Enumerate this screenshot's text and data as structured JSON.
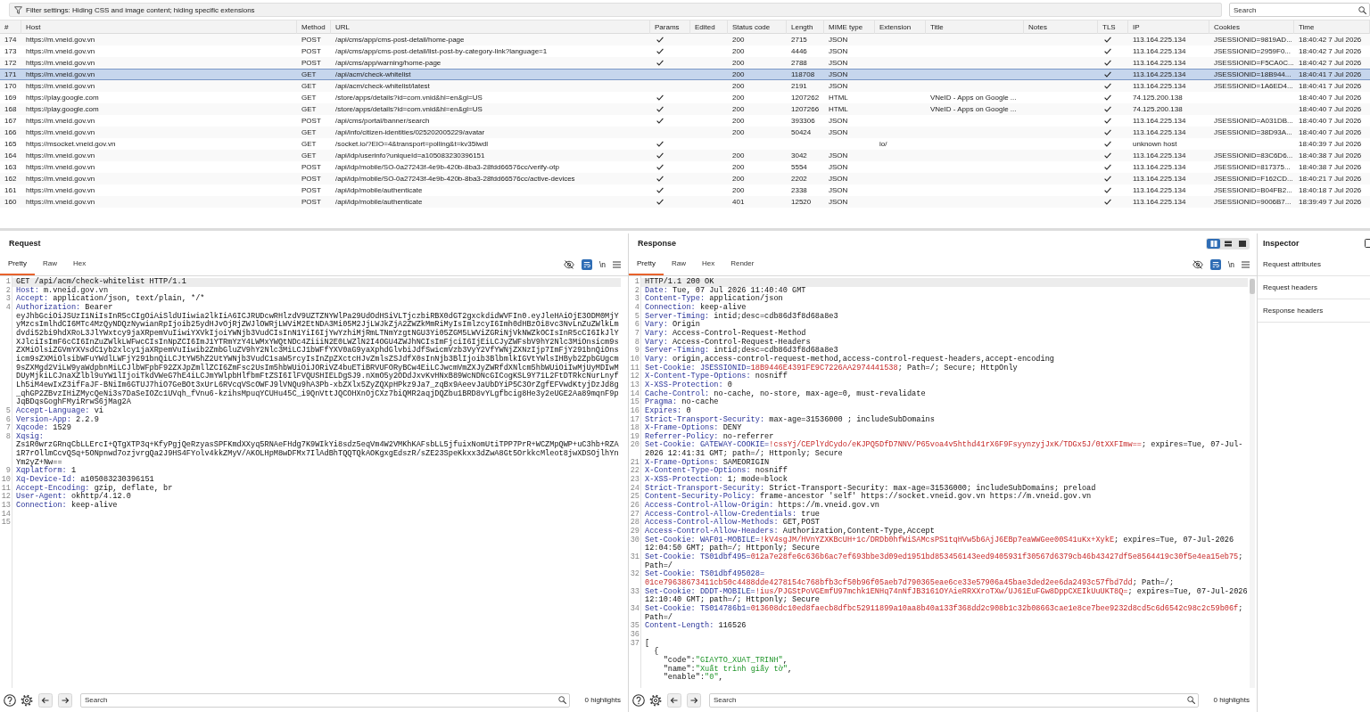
{
  "filter_bar": {
    "text": "Filter settings: Hiding CSS and image content; hiding specific extensions"
  },
  "search": {
    "placeholder": "Search"
  },
  "table": {
    "columns": [
      "#",
      "Host",
      "Method",
      "URL",
      "Params",
      "Edited",
      "Status code",
      "Length",
      "MIME type",
      "Extension",
      "Title",
      "Notes",
      "TLS",
      "IP",
      "Cookies",
      "Time"
    ],
    "rows": [
      {
        "num": "174",
        "host": "https://m.vneid.gov.vn",
        "method": "POST",
        "url": "/api/cms/app/cms-post-detail/home-page",
        "params": true,
        "status": "200",
        "length": "2715",
        "mime": "JSON",
        "tls": true,
        "ip": "113.164.225.134",
        "cookies": "JSESSIONID=9819AD...",
        "time": "18:40:42 7 Jul 2026",
        "selected": false
      },
      {
        "num": "173",
        "host": "https://m.vneid.gov.vn",
        "method": "POST",
        "url": "/api/cms/app/cms-post-detail/list-post-by-category-link?language=1",
        "params": true,
        "status": "200",
        "length": "4446",
        "mime": "JSON",
        "tls": true,
        "ip": "113.164.225.134",
        "cookies": "JSESSIONID=2959F0...",
        "time": "18:40:42 7 Jul 2026",
        "selected": false
      },
      {
        "num": "172",
        "host": "https://m.vneid.gov.vn",
        "method": "POST",
        "url": "/api/cms/app/warning/home-page",
        "params": true,
        "status": "200",
        "length": "2788",
        "mime": "JSON",
        "tls": true,
        "ip": "113.164.225.134",
        "cookies": "JSESSIONID=F5CA0C...",
        "time": "18:40:42 7 Jul 2026",
        "selected": false
      },
      {
        "num": "171",
        "host": "https://m.vneid.gov.vn",
        "method": "GET",
        "url": "/api/acm/check-whitelist",
        "params": false,
        "status": "200",
        "length": "118708",
        "mime": "JSON",
        "tls": true,
        "ip": "113.164.225.134",
        "cookies": "JSESSIONID=18B944...",
        "time": "18:40:41 7 Jul 2026",
        "selected": true
      },
      {
        "num": "170",
        "host": "https://m.vneid.gov.vn",
        "method": "GET",
        "url": "/api/acm/check-whitelist/latest",
        "params": false,
        "status": "200",
        "length": "2191",
        "mime": "JSON",
        "tls": true,
        "ip": "113.164.225.134",
        "cookies": "JSESSIONID=1A6ED4...",
        "time": "18:40:41 7 Jul 2026",
        "selected": false
      },
      {
        "num": "169",
        "host": "https://play.google.com",
        "method": "GET",
        "url": "/store/apps/details?id=com.vnid&hl=en&gl=US",
        "params": true,
        "status": "200",
        "length": "1207262",
        "mime": "HTML",
        "title": "VNeID - Apps on Google ...",
        "tls": true,
        "ip": "74.125.200.138",
        "time": "18:40:40 7 Jul 2026",
        "selected": false
      },
      {
        "num": "168",
        "host": "https://play.google.com",
        "method": "GET",
        "url": "/store/apps/details?id=com.vnid&hl=en&gl=US",
        "params": true,
        "status": "200",
        "length": "1207266",
        "mime": "HTML",
        "title": "VNeID - Apps on Google ...",
        "tls": true,
        "ip": "74.125.200.138",
        "time": "18:40:40 7 Jul 2026",
        "selected": false
      },
      {
        "num": "167",
        "host": "https://m.vneid.gov.vn",
        "method": "POST",
        "url": "/api/cms/portal/banner/search",
        "params": true,
        "status": "200",
        "length": "393306",
        "mime": "JSON",
        "tls": true,
        "ip": "113.164.225.134",
        "cookies": "JSESSIONID=A031DB...",
        "time": "18:40:40 7 Jul 2026",
        "selected": false
      },
      {
        "num": "166",
        "host": "https://m.vneid.gov.vn",
        "method": "GET",
        "url": "/api/info/citizen-identities/025202005229/avatar",
        "params": false,
        "status": "200",
        "length": "50424",
        "mime": "JSON",
        "tls": true,
        "ip": "113.164.225.134",
        "cookies": "JSESSIONID=38D93A...",
        "time": "18:40:40 7 Jul 2026",
        "selected": false
      },
      {
        "num": "165",
        "host": "https://msocket.vneid.gov.vn",
        "method": "GET",
        "url": "/socket.io/?EIO=4&transport=polling&t=kv35lwdl",
        "params": true,
        "extension": "io/",
        "tls": true,
        "ip": "unknown host",
        "time": "18:40:39 7 Jul 2026",
        "selected": false
      },
      {
        "num": "164",
        "host": "https://m.vneid.gov.vn",
        "method": "GET",
        "url": "/api/idp/userinfo?uniqueId=a105083230396151",
        "params": true,
        "status": "200",
        "length": "3042",
        "mime": "JSON",
        "tls": true,
        "ip": "113.164.225.134",
        "cookies": "JSESSIONID=83C6D6...",
        "time": "18:40:38 7 Jul 2026",
        "selected": false
      },
      {
        "num": "163",
        "host": "https://m.vneid.gov.vn",
        "method": "POST",
        "url": "/api/idp/mobile/SO-0a27243f-4e9b-420b-8ba3-28fdd66576cc/verify-otp",
        "params": true,
        "status": "200",
        "length": "5554",
        "mime": "JSON",
        "tls": true,
        "ip": "113.164.225.134",
        "cookies": "JSESSIONID=817375...",
        "time": "18:40:38 7 Jul 2026",
        "selected": false
      },
      {
        "num": "162",
        "host": "https://m.vneid.gov.vn",
        "method": "POST",
        "url": "/api/idp/mobile/SO-0a27243f-4e9b-420b-8ba3-28fdd66576cc/active-devices",
        "params": true,
        "status": "200",
        "length": "2202",
        "mime": "JSON",
        "tls": true,
        "ip": "113.164.225.134",
        "cookies": "JSESSIONID=F162CD...",
        "time": "18:40:21 7 Jul 2026",
        "selected": false
      },
      {
        "num": "161",
        "host": "https://m.vneid.gov.vn",
        "method": "POST",
        "url": "/api/idp/mobile/authenticate",
        "params": true,
        "status": "200",
        "length": "2338",
        "mime": "JSON",
        "tls": true,
        "ip": "113.164.225.134",
        "cookies": "JSESSIONID=B04FB2...",
        "time": "18:40:18 7 Jul 2026",
        "selected": false
      },
      {
        "num": "160",
        "host": "https://m.vneid.gov.vn",
        "method": "POST",
        "url": "/api/idp/mobile/authenticate",
        "params": true,
        "status": "401",
        "length": "12520",
        "mime": "JSON",
        "tls": true,
        "ip": "113.164.225.134",
        "cookies": "JSESSIONID=9006B7...",
        "time": "18:39:49 7 Jul 2026",
        "selected": false
      }
    ]
  },
  "request": {
    "title": "Request",
    "tabs": [
      {
        "label": "Pretty",
        "selected": true
      },
      {
        "label": "Raw",
        "selected": false
      },
      {
        "label": "Hex",
        "selected": false
      }
    ],
    "toolbar": {
      "wrap_on": true,
      "newline": "\\n"
    },
    "lines": [
      {
        "num": "1",
        "current": true,
        "segments": [
          {
            "kind": "plain",
            "text": "GET /api/acm/check-whitelist HTTP/1.1"
          }
        ]
      },
      {
        "num": "2",
        "current": false,
        "segments": [
          {
            "kind": "key",
            "text": "Host:"
          },
          {
            "kind": "value",
            "text": " m.vneid.gov.vn"
          }
        ]
      },
      {
        "num": "3",
        "current": false,
        "segments": [
          {
            "kind": "key",
            "text": "Accept:"
          },
          {
            "kind": "value",
            "text": " application/json, text/plain, */*"
          }
        ]
      },
      {
        "num": "4",
        "current": false,
        "segments": [
          {
            "kind": "key",
            "text": "Authorization:"
          },
          {
            "kind": "value",
            "text": " Bearer"
          },
          {
            "kind": "token",
            "text": "eyJhbGciOiJSUzI1NiIsInR5cCIgOiAiSldUIiwia2lkIiA6ICJRUDcwRHlzdV9UZTZNYWlPa29UdOdHSiVLTjczbiRBX0dGT2gxckdidWVFIn0.eyJleHAiOjE3ODM0MjYyMzcsImlhdCI6MTc4MzQyNDQzNywianRpIjoib25ydHJvOjRjZWJlOWRjLWViM2EtNDA3Mi05M2JjLWJkZjA2ZWZkMmRiMyIsImlzcyI6Imh0dHBzOi8vc3NvLnZuZWlkLmdvdi52bi9hdXRoL3JlYWxtcy9jaXRpemVuIiwiYXVkIjoiYWNjb3VudCIsInN1YiI6IjYwYzhiMjRmLTNmYzgtNGU3Yi05ZGM5LWViZGRiNjVkNWZkOCIsInR5cCI6IkJlYXJlciIsImF6cCI6InZuZWlkLWFwcCIsInNpZCI6ImJ1YTRmYzY4LWMxYWQtNDc4ZiiiN2E0LWZlN2I4OGU4ZWJhNCIsImFjciI6IjEiLCJyZWFsbV9hY2Nlc3MiOnsicm9sZXMiOlsiZGVmYXVsdC1yb2xlcy1jaXRpemVuIiwib2ZmbGluZV9hY2Nlc3MiLCJ1bWFfYXV0aG9yaXphdGlvbiJdfSwicmVzb3VyY2VfYWNjZXNzIjp7ImFjY291bnQiOnsicm9sZXMiOlsibWFuYWdlLWFjY291bnQiLCJtYW5hZ2UtYWNjb3VudC1saW5rcyIsInZpZXctcHJvZmlsZSJdfX0sInNjb3BlIjoib3BlbmlkIGVtYWlsIHByb2ZpbGUgcm9sZXMgd2ViLW9yaWdpbnMiLCJlbWFpbF92ZXJpZmllZCI6ZmFsc2UsIm5hbWUiOiJORiVZ4buETiBRVUFORyBCw4EiLCJwcmVmZXJyZWRfdXNlcm5hbWUiOiIwMjUyMDIwMDUyMjkiLCJnaXZlbl9uYW1lIjoiTkdVWeG7hE4iLCJmYWlpbHlfbmFtZSI6IlFVQUSHIELDgSJ9.nXmO5y2ODdJxvKvHNxB89WcNDNcGICogKSL9Y71L2FtDTRkcNurLnyfLh5iM4ewIxZ3ifFaJF-BNiIm6GTUJ7hiO7GeBOt3xUrL6RVcqVScOWFJ9lVNQu9hA3Pb-xbZXlx5ZyZQXpHPkz9Ja7_zqBx9AeevJaUbDYiP5C3OrZgfEFVwdKtyjDzJd8g_qhGP2ZBvzIHiZMycQeNi3s7DaSeIOZc1UVqh_fVnu6-kzihsMpuqYCUHu45C_i9QnVttJQCOHXnOjCXz7biQMR2aqjDQZbu1BRD8vYLgfbcig8He3y2eUGE2Aa89mqnF9pJqBDqsGoghFMyiRrwS6jMag2A"
          }
        ]
      },
      {
        "num": "5",
        "current": false,
        "segments": [
          {
            "kind": "key",
            "text": "Accept-Language:"
          },
          {
            "kind": "value",
            "text": " vi"
          }
        ]
      },
      {
        "num": "6",
        "current": false,
        "segments": [
          {
            "kind": "key",
            "text": "Version-App:"
          },
          {
            "kind": "value",
            "text": " 2.2.9"
          }
        ]
      },
      {
        "num": "7",
        "current": false,
        "segments": [
          {
            "kind": "key",
            "text": "Xqcode:"
          },
          {
            "kind": "value",
            "text": " 1529"
          }
        ]
      },
      {
        "num": "8",
        "current": false,
        "segments": [
          {
            "kind": "key",
            "text": "Xqsig:"
          },
          {
            "kind": "token",
            "text": "Zs1R0wrzGRnqCbLLErcI+QTgXTP3q+KfyPgjQeRzyasSPFKmdXXyq5RNAeFHdg7K9WIkYi8sdz5eqVm4W2VMKhKAFsbLL5jfuixNomUtiTPP7PrR+WCZMpQWP+uC3hb+RZA1R7rOllmCcvQSq+5ONpnwd7ozjvrgQa2J9HS4FYolv4kkZMyV/AKOLHpM8wDFMx7IlAdBhTQQTQkAOKgxgEdszR/sZE23SpeKkxx3dZwA8Gt5OrkkcMleot8jwXDSOjlhYnYm2yZ+Nw=="
          }
        ]
      },
      {
        "num": "9",
        "current": false,
        "segments": [
          {
            "kind": "key",
            "text": "Xqplatform:"
          },
          {
            "kind": "value",
            "text": " 1"
          }
        ]
      },
      {
        "num": "10",
        "current": false,
        "segments": [
          {
            "kind": "key",
            "text": "Xq-Device-Id:"
          },
          {
            "kind": "value",
            "text": " a105083230396151"
          }
        ]
      },
      {
        "num": "11",
        "current": false,
        "segments": [
          {
            "kind": "key",
            "text": "Accept-Encoding:"
          },
          {
            "kind": "value",
            "text": " gzip, deflate, br"
          }
        ]
      },
      {
        "num": "12",
        "current": false,
        "segments": [
          {
            "kind": "key",
            "text": "User-Agent:"
          },
          {
            "kind": "value",
            "text": " okhttp/4.12.0"
          }
        ]
      },
      {
        "num": "13",
        "current": false,
        "segments": [
          {
            "kind": "key",
            "text": "Connection:"
          },
          {
            "kind": "value",
            "text": " keep-alive"
          }
        ]
      },
      {
        "num": "14",
        "current": false
      },
      {
        "num": "15",
        "current": false
      }
    ],
    "search": {
      "placeholder": "Search"
    },
    "highlights": "0 highlights"
  },
  "response": {
    "title": "Response",
    "layout_buttons": [
      {
        "kind": "side_by_side",
        "selected": true
      },
      {
        "kind": "stacked",
        "selected": false
      },
      {
        "kind": "single",
        "selected": false
      }
    ],
    "tabs": [
      {
        "label": "Pretty",
        "selected": true
      },
      {
        "label": "Raw",
        "selected": false
      },
      {
        "label": "Hex",
        "selected": false
      },
      {
        "label": "Render",
        "selected": false
      }
    ],
    "toolbar": {
      "wrap_on": true,
      "newline": "\\n"
    },
    "lines": [
      {
        "num": "1",
        "current": true,
        "segments": [
          {
            "kind": "plain",
            "text": "HTTP/1.1 200 OK"
          }
        ]
      },
      {
        "num": "2",
        "current": false,
        "segments": [
          {
            "kind": "key",
            "text": "Date:"
          },
          {
            "kind": "value",
            "text": " Tue, 07 Jul 2026 11:40:40 GMT"
          }
        ]
      },
      {
        "num": "3",
        "current": false,
        "segments": [
          {
            "kind": "key",
            "text": "Content-Type:"
          },
          {
            "kind": "value",
            "text": " application/json"
          }
        ]
      },
      {
        "num": "4",
        "current": false,
        "segments": [
          {
            "kind": "key",
            "text": "Connection:"
          },
          {
            "kind": "value",
            "text": " keep-alive"
          }
        ]
      },
      {
        "num": "5",
        "current": false,
        "segments": [
          {
            "kind": "key",
            "text": "Server-Timing:"
          },
          {
            "kind": "value",
            "text": " intid;desc=cdb86d3f8d68a8e3"
          }
        ]
      },
      {
        "num": "6",
        "current": false,
        "segments": [
          {
            "kind": "key",
            "text": "Vary:"
          },
          {
            "kind": "value",
            "text": " Origin"
          }
        ]
      },
      {
        "num": "7",
        "current": false,
        "segments": [
          {
            "kind": "key",
            "text": "Vary:"
          },
          {
            "kind": "value",
            "text": " Access-Control-Request-Method"
          }
        ]
      },
      {
        "num": "8",
        "current": false,
        "segments": [
          {
            "kind": "key",
            "text": "Vary:"
          },
          {
            "kind": "value",
            "text": " Access-Control-Request-Headers"
          }
        ]
      },
      {
        "num": "9",
        "current": false,
        "segments": [
          {
            "kind": "key",
            "text": "Server-Timing:"
          },
          {
            "kind": "value",
            "text": " intid;desc=cdb86d3f8d68a8e3"
          }
        ]
      },
      {
        "num": "10",
        "current": false,
        "segments": [
          {
            "kind": "key",
            "text": "Vary:"
          },
          {
            "kind": "value",
            "text": " origin,access-control-request-method,access-control-request-headers,accept-encoding"
          }
        ]
      },
      {
        "num": "11",
        "current": false,
        "segments": [
          {
            "kind": "key",
            "text": "Set-Cookie:"
          },
          {
            "kind": "cookie_name",
            "text": " JSESSIONID="
          },
          {
            "kind": "cookie_value",
            "text": "18B9446E4391FE9C7226AA2974441538"
          },
          {
            "kind": "value",
            "text": "; Path=/; Secure; HttpOnly"
          }
        ]
      },
      {
        "num": "12",
        "current": false,
        "segments": [
          {
            "kind": "key",
            "text": "X-Content-Type-Options:"
          },
          {
            "kind": "value",
            "text": " nosniff"
          }
        ]
      },
      {
        "num": "13",
        "current": false,
        "segments": [
          {
            "kind": "key",
            "text": "X-XSS-Protection:"
          },
          {
            "kind": "value",
            "text": " 0"
          }
        ]
      },
      {
        "num": "14",
        "current": false,
        "segments": [
          {
            "kind": "key",
            "text": "Cache-Control:"
          },
          {
            "kind": "value",
            "text": " no-cache, no-store, max-age=0, must-revalidate"
          }
        ]
      },
      {
        "num": "15",
        "current": false,
        "segments": [
          {
            "kind": "key",
            "text": "Pragma:"
          },
          {
            "kind": "value",
            "text": " no-cache"
          }
        ]
      },
      {
        "num": "16",
        "current": false,
        "segments": [
          {
            "kind": "key",
            "text": "Expires:"
          },
          {
            "kind": "value",
            "text": " 0"
          }
        ]
      },
      {
        "num": "17",
        "current": false,
        "segments": [
          {
            "kind": "key",
            "text": "Strict-Transport-Security:"
          },
          {
            "kind": "value",
            "text": " max-age=31536000 ; includeSubDomains"
          }
        ]
      },
      {
        "num": "18",
        "current": false,
        "segments": [
          {
            "kind": "key",
            "text": "X-Frame-Options:"
          },
          {
            "kind": "value",
            "text": " DENY"
          }
        ]
      },
      {
        "num": "19",
        "current": false,
        "segments": [
          {
            "kind": "key",
            "text": "Referrer-Policy:"
          },
          {
            "kind": "value",
            "text": " no-referrer"
          }
        ]
      },
      {
        "num": "20",
        "current": false,
        "segments": [
          {
            "kind": "key",
            "text": "Set-Cookie:"
          },
          {
            "kind": "cookie_name",
            "text": " GATEWAY-COOKIE="
          },
          {
            "kind": "cookie_value",
            "text": "!cssYj/CEPlYdCydo/eKJPQ5DfD7NNV/P65voa4v5hthd41rX6F9FsyynzyjJxK/TDGx5J/0tXXFImw=="
          },
          {
            "kind": "value",
            "text": "; expires=Tue, 07-Jul-2026 12:41:31 GMT; path=/; Httponly; Secure"
          }
        ]
      },
      {
        "num": "21",
        "current": false,
        "segments": [
          {
            "kind": "key",
            "text": "X-Frame-Options:"
          },
          {
            "kind": "value",
            "text": " SAMEORIGIN"
          }
        ]
      },
      {
        "num": "22",
        "current": false,
        "segments": [
          {
            "kind": "key",
            "text": "X-Content-Type-Options:"
          },
          {
            "kind": "value",
            "text": " nosniff"
          }
        ]
      },
      {
        "num": "23",
        "current": false,
        "segments": [
          {
            "kind": "key",
            "text": "X-XSS-Protection:"
          },
          {
            "kind": "value",
            "text": " 1; mode=block"
          }
        ]
      },
      {
        "num": "24",
        "current": false,
        "segments": [
          {
            "kind": "key",
            "text": "Strict-Transport-Security:"
          },
          {
            "kind": "value",
            "text": " Strict-Transport-Security: max-age=31536000; includeSubDomains; preload"
          }
        ]
      },
      {
        "num": "25",
        "current": false,
        "segments": [
          {
            "kind": "key",
            "text": "Content-Security-Policy:"
          },
          {
            "kind": "value",
            "text": " frame-ancestor 'self' https://socket.vneid.gov.vn https://m.vneid.gov.vn"
          }
        ]
      },
      {
        "num": "26",
        "current": false,
        "segments": [
          {
            "kind": "key",
            "text": "Access-Control-Allow-Origin:"
          },
          {
            "kind": "value",
            "text": " https://m.vneid.gov.vn"
          }
        ]
      },
      {
        "num": "27",
        "current": false,
        "segments": [
          {
            "kind": "key",
            "text": "Access-Control-Allow-Credentials:"
          },
          {
            "kind": "value",
            "text": " true"
          }
        ]
      },
      {
        "num": "28",
        "current": false,
        "segments": [
          {
            "kind": "key",
            "text": "Access-Control-Allow-Methods:"
          },
          {
            "kind": "value",
            "text": " GET,POST"
          }
        ]
      },
      {
        "num": "29",
        "current": false,
        "segments": [
          {
            "kind": "key",
            "text": "Access-Control-Allow-Headers:"
          },
          {
            "kind": "value",
            "text": " Authorization,Content-Type,Accept"
          }
        ]
      },
      {
        "num": "30",
        "current": false,
        "segments": [
          {
            "kind": "key",
            "text": "Set-Cookie:"
          },
          {
            "kind": "cookie_name",
            "text": " WAF01-MOBILE="
          },
          {
            "kind": "cookie_value",
            "text": "!kV4sgJM/HVnYZXKBcUH+1c/DRDb0hfWiSAMcsPS1tqHVw5b6AjJ6EBp7eaWWGee00S41uKx+XykE"
          },
          {
            "kind": "value",
            "text": "; expires=Tue, 07-Jul-2026 12:04:50 GMT; path=/; Httponly; Secure"
          }
        ]
      },
      {
        "num": "31",
        "current": false,
        "segments": [
          {
            "kind": "key",
            "text": "Set-Cookie:"
          },
          {
            "kind": "cookie_name",
            "text": " TS01dbf495="
          },
          {
            "kind": "cookie_value",
            "text": "012a7e28fe6c636b6ac7ef693bbe3d09ed1951bd853456143eed9405931f30567d6379cb46b43427df5e8564419c30f5e4ea15eb75"
          },
          {
            "kind": "value",
            "text": "; Path=/"
          }
        ]
      },
      {
        "num": "32",
        "current": false,
        "segments": [
          {
            "kind": "key",
            "text": "Set-Cookie:"
          },
          {
            "kind": "cookie_name",
            "text": " TS01dbf495028="
          },
          {
            "kind": "cookie_value",
            "text": "01ce79638673411cb50c4488dde4278154c768bfb3cf50b96f05aeb7d790365eae6ce33e57906a45bae3ded2ee6da2493c57fbd7dd"
          },
          {
            "kind": "value",
            "text": "; Path=/;"
          }
        ]
      },
      {
        "num": "33",
        "current": false,
        "segments": [
          {
            "kind": "key",
            "text": "Set-Cookie:"
          },
          {
            "kind": "cookie_name",
            "text": " DDDT-MOBILE="
          },
          {
            "kind": "cookie_value",
            "text": "!ius/PJGStPoVGEmfU97mchk1ENHq74nNfJB3161OYAieRRXXroTXw/UJ61EuFGw8DppCXEIkUuUKT8Q="
          },
          {
            "kind": "value",
            "text": "; expires=Tue, 07-Jul-2026 12:10:40 GMT; path=/; Httponly; Secure"
          }
        ]
      },
      {
        "num": "34",
        "current": false,
        "segments": [
          {
            "kind": "key",
            "text": "Set-Cookie:"
          },
          {
            "kind": "cookie_name",
            "text": " TS014786b1="
          },
          {
            "kind": "cookie_value",
            "text": "013608dc10ed8faecb8dfbc52911899a10aa8b40a133f368dd2c908b1c32b08663cae1e8ce7bee9232d8cd5c6d6542c98c2c59b06f"
          },
          {
            "kind": "value",
            "text": "; Path=/"
          }
        ]
      },
      {
        "num": "35",
        "current": false,
        "segments": [
          {
            "kind": "key",
            "text": "Content-Length:"
          },
          {
            "kind": "value",
            "text": " 116526"
          }
        ]
      },
      {
        "num": "36",
        "current": false
      },
      {
        "num": "37",
        "current": false,
        "segments": [
          {
            "kind": "punct",
            "text": "["
          }
        ],
        "children": [
          {
            "current": false,
            "segments": [
              {
                "kind": "punct",
                "text": "{"
              }
            ],
            "children": [
              {
                "current": false,
                "segments": [
                  {
                    "kind": "json_key",
                    "text": "\"code\""
                  },
                  {
                    "kind": "punct",
                    "text": ":"
                  },
                  {
                    "kind": "json_string",
                    "text": "\"GIAYTO_XUAT_TRINH\""
                  },
                  {
                    "kind": "punct",
                    "text": ","
                  }
                ]
              },
              {
                "current": false,
                "segments": [
                  {
                    "kind": "json_key",
                    "text": "\"name\""
                  },
                  {
                    "kind": "punct",
                    "text": ":"
                  },
                  {
                    "kind": "json_string",
                    "text": "\"Xuất trình giấy tờ\""
                  },
                  {
                    "kind": "punct",
                    "text": ","
                  }
                ]
              },
              {
                "current": false,
                "segments": [
                  {
                    "kind": "json_key",
                    "text": "\"enable\""
                  },
                  {
                    "kind": "punct",
                    "text": ":"
                  },
                  {
                    "kind": "json_string",
                    "text": "\"0\""
                  },
                  {
                    "kind": "punct",
                    "text": ","
                  }
                ]
              }
            ]
          }
        ]
      }
    ],
    "search": {
      "placeholder": "Search"
    },
    "highlights": "0 highlights"
  },
  "inspector": {
    "title": "Inspector",
    "sections": [
      "Request attributes",
      "Request headers",
      "Response headers"
    ]
  }
}
